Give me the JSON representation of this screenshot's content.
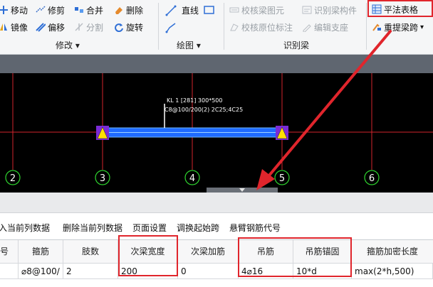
{
  "ribbon": {
    "modify": {
      "move": "移动",
      "trim": "修剪",
      "merge": "合并",
      "delete": "删除",
      "mirror": "镜像",
      "offset": "偏移",
      "split": "分割",
      "rotate": "旋转",
      "group_label": "修改"
    },
    "draw": {
      "line": "直线",
      "group_label": "绘图"
    },
    "identify": {
      "check_diagram": "校核梁图元",
      "check_original": "校核原位标注",
      "identify_component": "识别梁构件",
      "edit_support": "编辑支座",
      "group_label": "识别梁"
    },
    "right": {
      "table_button": "平法表格",
      "reextract_span": "重提梁跨"
    }
  },
  "canvas": {
    "annotation_line1": "KL 1 [281] 300*500",
    "annotation_line2": "C8@100/200(2) 2C25;4C25",
    "axis_labels": [
      "2",
      "3",
      "4",
      "5",
      "6"
    ]
  },
  "toolbar2": {
    "insert_col": "入当前列数据",
    "delete_col": "删除当前列数据",
    "page_setup": "页面设置",
    "swap_span": "调换起始跨",
    "cantilever_code": "悬臂钢筋代号"
  },
  "table": {
    "headers": [
      "号",
      "箍筋",
      "肢数",
      "次梁宽度",
      "次梁加筋",
      "吊筋",
      "吊筋锚固",
      "箍筋加密长度"
    ],
    "row": [
      "",
      "⌀8@100/",
      "2",
      "200",
      "0",
      "4⌀16",
      "10*d",
      "max(2*h,500)"
    ]
  },
  "colors": {
    "highlight": "#e0252c",
    "beam": "#1f6bff",
    "grid_line": "#d2242c",
    "support": "#7b2bd6"
  }
}
